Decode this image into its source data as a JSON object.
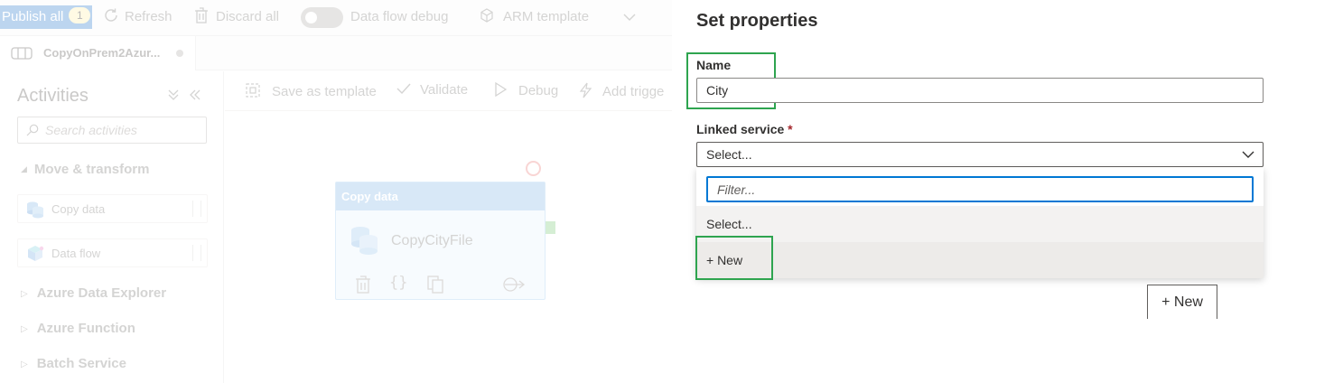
{
  "topbar": {
    "publish_label": "Publish all",
    "publish_count": "1",
    "refresh_label": "Refresh",
    "discard_label": "Discard all",
    "data_flow_debug_label": "Data flow debug",
    "arm_template_label": "ARM template"
  },
  "tab": {
    "name": "CopyOnPrem2Azur..."
  },
  "sidebar": {
    "title": "Activities",
    "search_placeholder": "Search activities",
    "categories": [
      {
        "label": "Move & transform",
        "expanded": true
      },
      {
        "label": "Azure Data Explorer",
        "expanded": false
      },
      {
        "label": "Azure Function",
        "expanded": false
      },
      {
        "label": "Batch Service",
        "expanded": false
      }
    ],
    "activities": [
      {
        "label": "Copy data",
        "icon": "database-icon"
      },
      {
        "label": "Data flow",
        "icon": "data-flow-icon"
      }
    ]
  },
  "canvas_toolbar": {
    "save_template_label": "Save as template",
    "validate_label": "Validate",
    "debug_label": "Debug",
    "add_trigger_label": "Add trigge"
  },
  "node": {
    "type_label": "Copy data",
    "name": "CopyCityFile"
  },
  "panel": {
    "title": "Set properties",
    "name_label": "Name",
    "name_value": "City",
    "linked_service_label": "Linked service",
    "required_mark": "*",
    "select_value": "Select...",
    "filter_placeholder": "Filter...",
    "options": [
      "Select...",
      "+ New"
    ],
    "new_button_label": "+ New"
  },
  "colors": {
    "highlight": "#2ea44f",
    "focus": "#0078d4",
    "publish_bg": "#6aa3dc"
  }
}
